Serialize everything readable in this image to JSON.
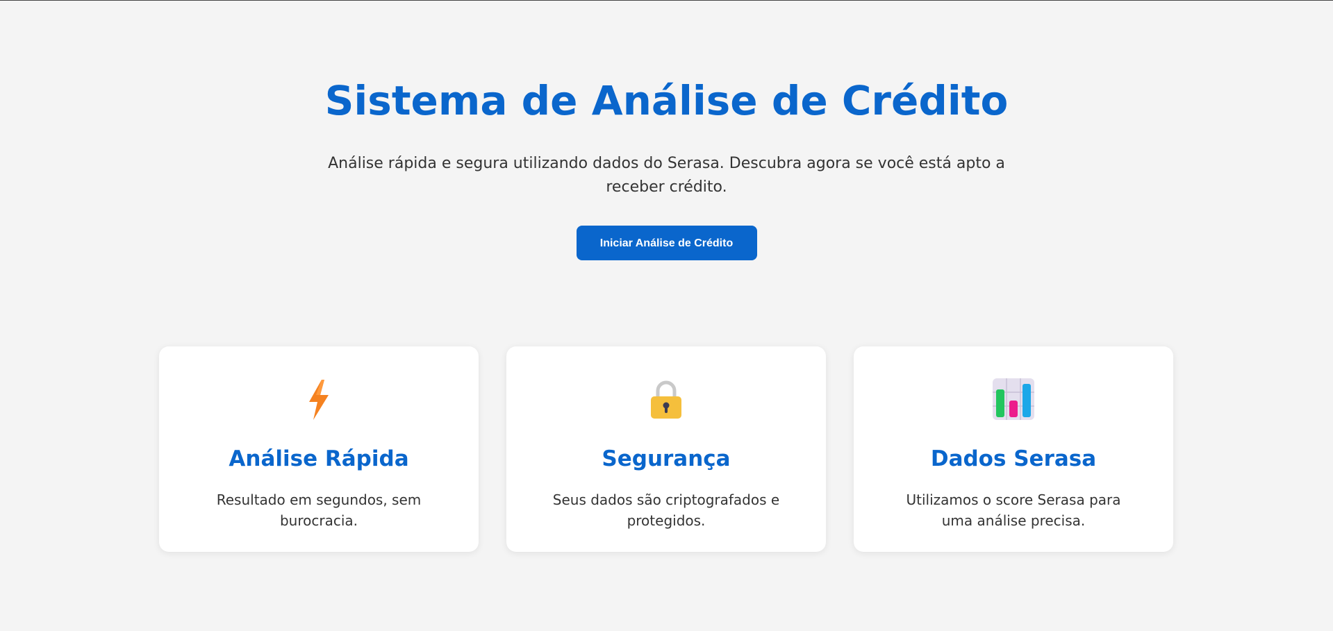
{
  "hero": {
    "title": "Sistema de Análise de Crédito",
    "subtitle": "Análise rápida e segura utilizando dados do Serasa. Descubra agora se você está apto a receber crédito.",
    "cta_label": "Iniciar Análise de Crédito"
  },
  "features": [
    {
      "icon": "lightning-icon",
      "title": "Análise Rápida",
      "text": "Resultado em segundos, sem burocracia."
    },
    {
      "icon": "lock-icon",
      "title": "Segurança",
      "text": "Seus dados são criptografados e protegidos."
    },
    {
      "icon": "bar-chart-icon",
      "title": "Dados Serasa",
      "text": "Utilizamos o score Serasa para uma análise precisa."
    }
  ],
  "colors": {
    "primary": "#0a66cc",
    "background": "#f4f4f4",
    "text": "#333333",
    "card": "#ffffff"
  }
}
